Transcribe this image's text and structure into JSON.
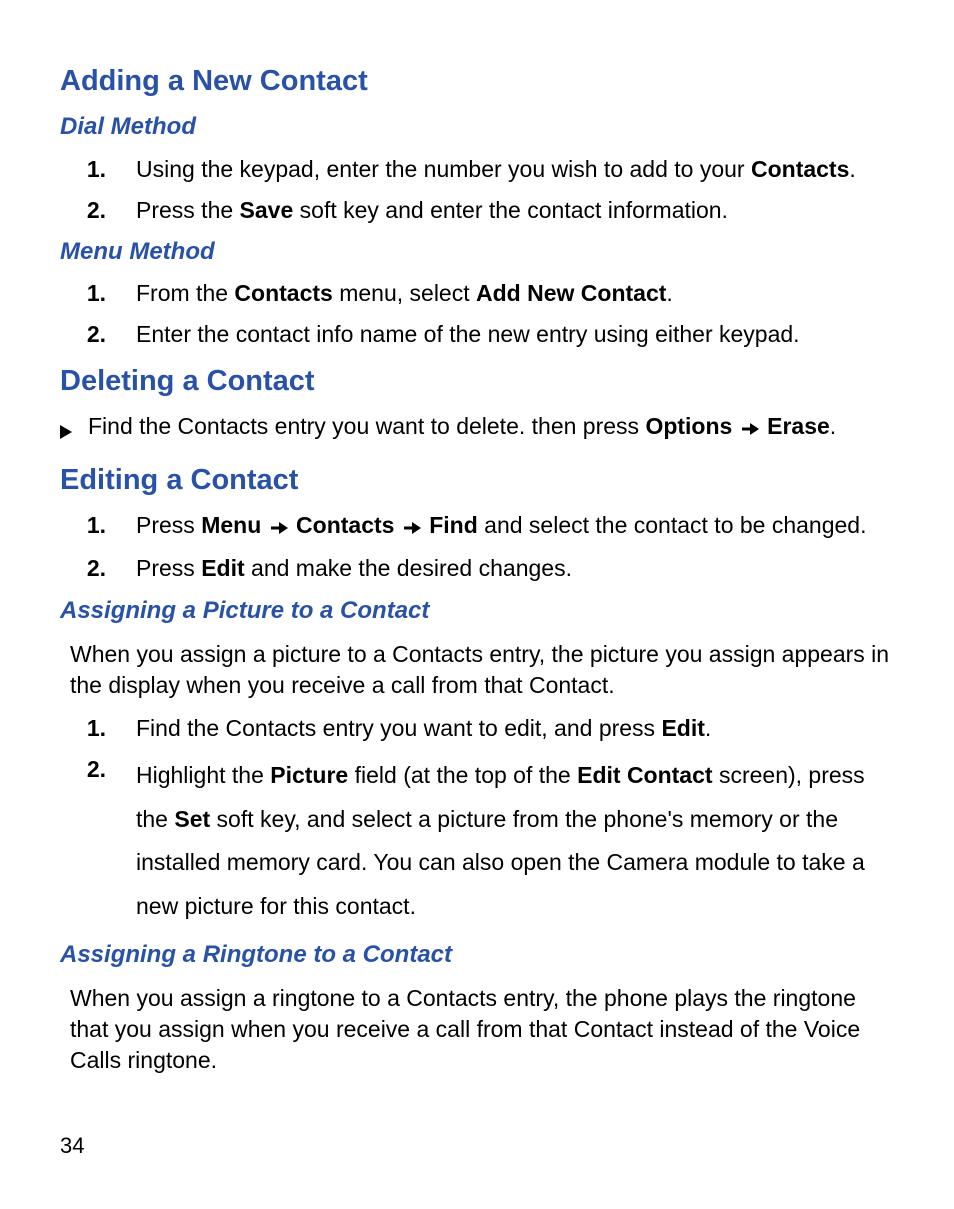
{
  "pageNumber": "34",
  "section1": {
    "title": "Adding a New Contact",
    "sub1": {
      "title": "Dial Method",
      "items": [
        {
          "num": "1.",
          "parts": [
            "Using the keypad, enter the number you wish to add to your ",
            {
              "b": "Contacts"
            },
            "."
          ]
        },
        {
          "num": "2.",
          "parts": [
            "Press the ",
            {
              "b": "Save"
            },
            " soft key and enter the contact information."
          ]
        }
      ]
    },
    "sub2": {
      "title": "Menu Method",
      "items": [
        {
          "num": "1.",
          "parts": [
            "From the ",
            {
              "b": "Contacts"
            },
            " menu, select ",
            {
              "b": "Add New Contact"
            },
            "."
          ]
        },
        {
          "num": "2.",
          "parts": [
            "Enter the contact info name of the new entry using either keypad."
          ]
        }
      ]
    }
  },
  "section2": {
    "title": "Deleting a Contact",
    "bullet": {
      "parts": [
        "Find the Contacts entry you want to delete. then press ",
        {
          "b": "Options"
        },
        " ",
        {
          "arrow": true
        },
        " ",
        {
          "b": "Erase"
        },
        "."
      ]
    }
  },
  "section3": {
    "title": "Editing a Contact",
    "items": [
      {
        "num": "1.",
        "parts": [
          "Press ",
          {
            "b": "Menu"
          },
          " ",
          {
            "arrow": true
          },
          " ",
          {
            "b": "Contacts"
          },
          " ",
          {
            "arrow": true
          },
          " ",
          {
            "b": "Find"
          },
          " and select the contact to be changed."
        ]
      },
      {
        "num": "2.",
        "parts": [
          "Press ",
          {
            "b": "Edit"
          },
          " and make the desired changes."
        ]
      }
    ],
    "sub1": {
      "title": "Assigning a Picture to a Contact",
      "intro": "When you assign a picture to a Contacts entry, the picture you assign appears in the display when you receive a call from that Contact.",
      "items": [
        {
          "num": "1.",
          "loose": false,
          "parts": [
            "Find the Contacts entry you want to edit, and press ",
            {
              "b": "Edit"
            },
            "."
          ]
        },
        {
          "num": "2.",
          "loose": true,
          "parts": [
            "Highlight the ",
            {
              "b": "Picture"
            },
            " field (at the top of the ",
            {
              "b": "Edit Contact"
            },
            " screen), press the ",
            {
              "b": "Set"
            },
            " soft key, and select a picture from the phone's memory or the installed memory card.  You can also open the Camera module to take a new picture for this contact."
          ]
        }
      ]
    },
    "sub2": {
      "title": "Assigning a Ringtone to a Contact",
      "intro": "When you assign a ringtone to a Contacts entry, the phone plays the ringtone that you assign when you receive a call from that Contact instead of the Voice Calls ringtone."
    }
  }
}
